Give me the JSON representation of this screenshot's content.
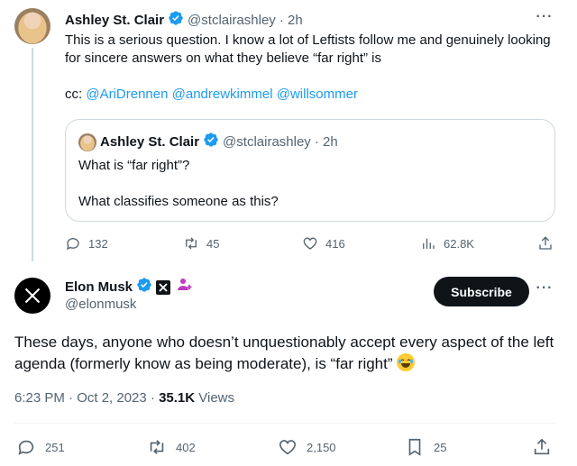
{
  "tweet1": {
    "author_name": "Ashley St. Clair",
    "author_handle": "@stclairashley",
    "time": "· 2h",
    "text": "This is a serious question. I know a lot of Leftists follow me and genuinely looking for sincere answers on what they believe “far right” is",
    "cc_label": "cc:",
    "mentions": [
      "@AriDrennen",
      "@andrewkimmel",
      "@willsommer"
    ],
    "quote": {
      "author_name": "Ashley St. Clair",
      "author_handle": "@stclairashley",
      "time": "· 2h",
      "line1": "What is “far right”?",
      "line2": "What classifies someone as this?"
    },
    "stats": {
      "replies": "132",
      "reposts": "45",
      "likes": "416",
      "views": "62.8K"
    }
  },
  "tweet2": {
    "author_name": "Elon Musk",
    "author_handle": "@elonmusk",
    "subscribe_label": "Subscribe",
    "text": "These days, anyone who doesn’t unquestionably accept every aspect of the left agenda (formerly know as being moderate), is “far right”",
    "time": "6:23 PM · Oct 2, 2023 · ",
    "views_count": "35.1K",
    "views_label": " Views",
    "stats": {
      "replies": "251",
      "reposts": "402",
      "likes": "2,150",
      "bookmarks": "25"
    }
  },
  "colors": {
    "accent": "#1d9bf0",
    "muted": "#536471",
    "verified": "#1d9bf0",
    "subscribe_bg": "#0f1419",
    "affiliate_badge": "#c03bc4"
  },
  "icons": [
    "verified-badge-icon",
    "more-icon",
    "reply-icon",
    "repost-icon",
    "like-icon",
    "views-icon",
    "share-icon",
    "bookmark-icon",
    "x-logo-icon",
    "affiliate-badge-icon",
    "laughing-emoji-icon"
  ]
}
